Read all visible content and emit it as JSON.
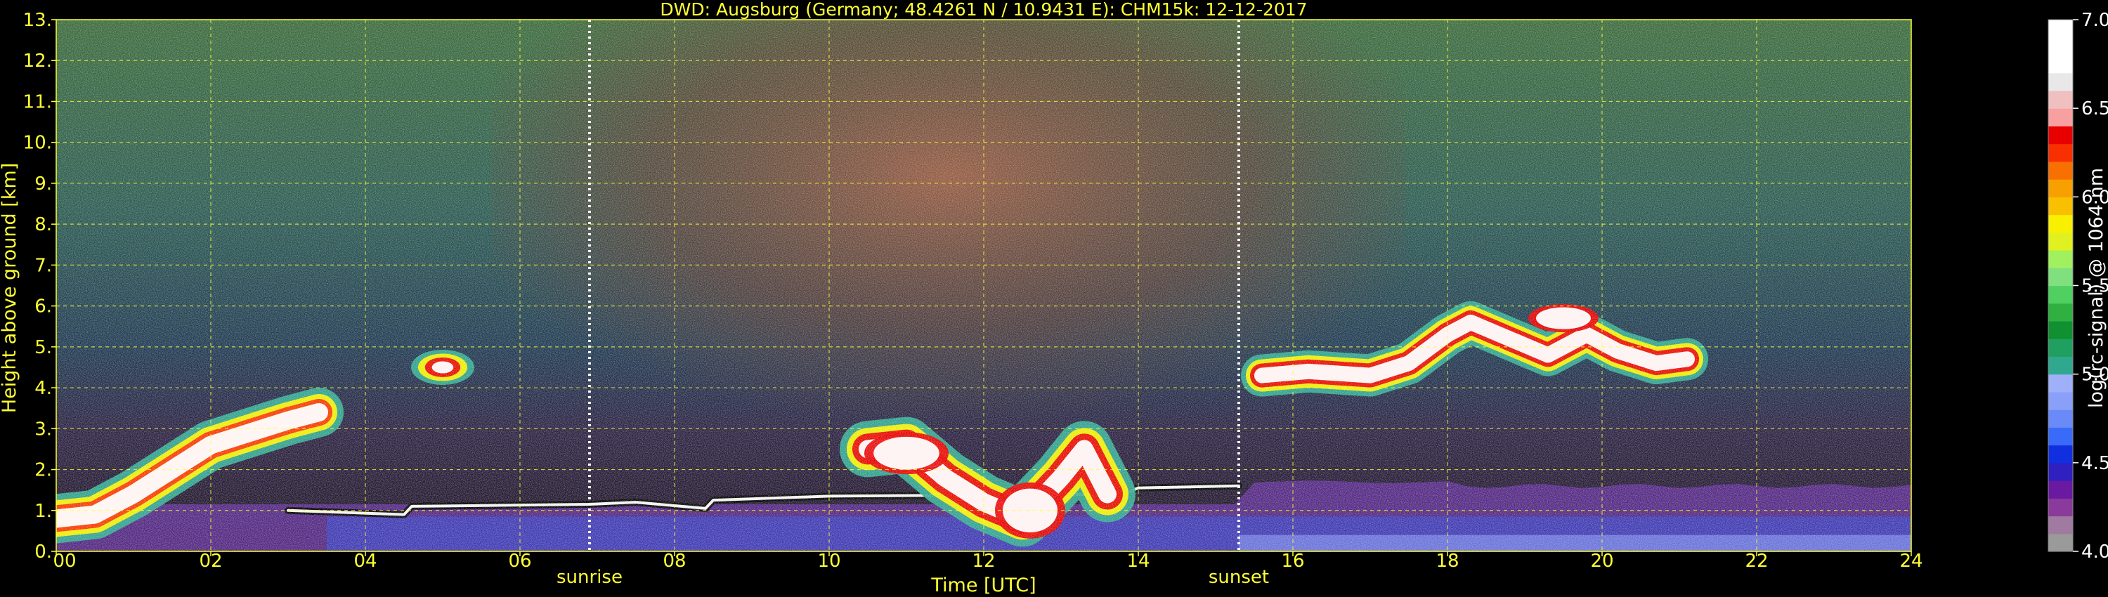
{
  "chart_data": {
    "type": "heatmap",
    "title": "DWD: Augsburg (Germany; 48.4261 N / 10.9431 E):    CHM15k: 12-12-2017",
    "xlabel": "Time [UTC]",
    "ylabel": "Height above ground [km]",
    "xlim": [
      0,
      24
    ],
    "ylim": [
      0,
      13
    ],
    "xticks": [
      "00",
      "02",
      "04",
      "06",
      "08",
      "10",
      "12",
      "14",
      "16",
      "18",
      "20",
      "22",
      "24"
    ],
    "yticks": [
      "0.",
      "1.",
      "2.",
      "3.",
      "4.",
      "5.",
      "6.",
      "7.",
      "8.",
      "9.",
      "10.",
      "11.",
      "12.",
      "13."
    ],
    "grid": true,
    "annotations": [
      {
        "label": "sunrise",
        "time": 6.9
      },
      {
        "label": "sunset",
        "time": 15.3
      }
    ],
    "colorbar": {
      "label": "log(rc-signal) @ 1064 nm",
      "min": 4.0,
      "max": 7.0,
      "ticks": [
        "4.0",
        "4.5",
        "5.0",
        "5.5",
        "6.0",
        "6.5",
        "7.0"
      ],
      "colors": [
        "#9a9a9a",
        "#a07aa0",
        "#8a3a9a",
        "#6a1aa0",
        "#3020c0",
        "#1030e0",
        "#3a6af8",
        "#6a8af8",
        "#8aa0f8",
        "#a0b0f8",
        "#30a890",
        "#20a060",
        "#109030",
        "#30b040",
        "#50d060",
        "#80e080",
        "#a0f060",
        "#e0f020",
        "#f8f000",
        "#f8c000",
        "#f8a000",
        "#f87000",
        "#f83000",
        "#e80000",
        "#f8a0a0",
        "#f0c0c0",
        "#e8e8e8",
        "#ffffff",
        "#ffffff",
        "#ffffff"
      ]
    },
    "features": [
      {
        "name": "boundary layer aerosol (rising)",
        "t_start": 0.0,
        "t_end": 3.4,
        "h_start": 0.7,
        "h_end": 3.5
      },
      {
        "name": "low layer top",
        "t_start": 3.0,
        "t_end": 15.3,
        "h": 1.2
      },
      {
        "name": "cloud 4.5 km",
        "t_start": 4.7,
        "t_end": 5.4,
        "h_start": 4.0,
        "h_end": 5.0
      },
      {
        "name": "low clouds",
        "t_start": 10.5,
        "t_end": 13.6,
        "h_start": 0.0,
        "h_end": 3.0
      },
      {
        "name": "mid-level clouds",
        "t_start": 15.6,
        "t_end": 21.1,
        "h_start": 4.0,
        "h_end": 5.9
      }
    ]
  }
}
